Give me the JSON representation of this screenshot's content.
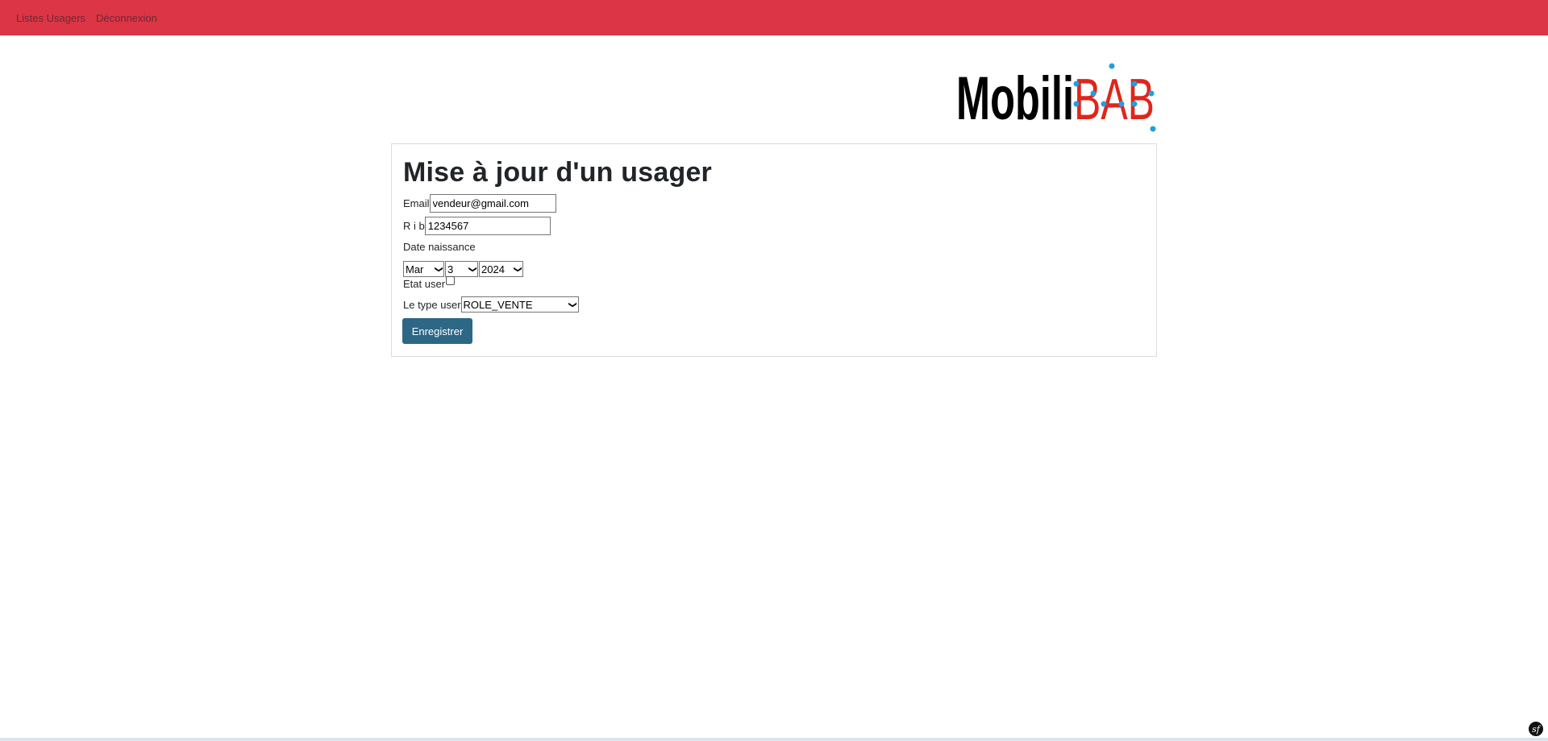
{
  "nav": {
    "items": [
      "Listes Usagers",
      "Déconnexion"
    ]
  },
  "logo": {
    "part1": "Mobili",
    "part2": "BAB",
    "colors": {
      "text": "#000000",
      "accent": "#e0251b",
      "dots": "#1fa0e0"
    }
  },
  "form": {
    "title": "Mise à jour d'un usager",
    "email_label": "Email",
    "email_value": "vendeur@gmail.com",
    "rib_label": "R i b",
    "rib_value": "1234567",
    "date_label": "Date naissance",
    "date_month": "Mar",
    "date_day": "3",
    "date_year": "2024",
    "etat_label": "Etat user",
    "type_label": "Le type user",
    "type_value": "ROLE_VENTE",
    "submit_label": "Enregistrer"
  },
  "footer": {
    "badge": "sf"
  },
  "colors": {
    "navbar": "#dc3545",
    "button": "#2d6786"
  }
}
